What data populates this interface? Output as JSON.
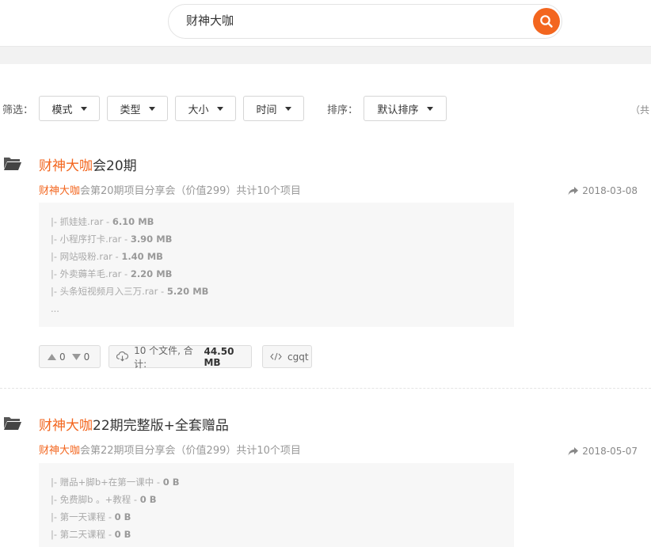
{
  "search": {
    "value": "财神大咖"
  },
  "filter": {
    "label": "筛选：",
    "dropdowns": [
      "模式",
      "类型",
      "大小",
      "时间"
    ],
    "sort_label": "排序：",
    "sort_value": "默认排序",
    "edge_text": "（共"
  },
  "results": [
    {
      "title_highlight": "财神大咖",
      "title_rest": "会20期",
      "desc_highlight": "财神大咖",
      "desc_rest": "会第20期项目分享会（价值299）共计10个项目",
      "date": "2018-03-08",
      "files": [
        {
          "name": "|- 抓娃娃.rar - ",
          "size": "6.10 MB"
        },
        {
          "name": "|- 小程序打卡.rar - ",
          "size": "3.90 MB"
        },
        {
          "name": "|- 网站吸粉.rar - ",
          "size": "1.40 MB"
        },
        {
          "name": "|- 外卖薅羊毛.rar - ",
          "size": "2.20 MB"
        },
        {
          "name": "|- 头条短视频月入三万.rar - ",
          "size": "5.20 MB"
        }
      ],
      "more": "...",
      "upvotes": "0",
      "downvotes": "0",
      "file_count": "10 个文件, 合计: ",
      "total_size": "44.50 MB",
      "code": "cgqt"
    },
    {
      "title_highlight": "财神大咖",
      "title_rest": "22期完整版+全套赠品",
      "desc_highlight": "财神大咖",
      "desc_rest": "会第22期项目分享会（价值299）共计10个项目",
      "date": "2018-05-07",
      "files": [
        {
          "name": "|- 赠品+脚b+在第一课中 - ",
          "size": "0 B"
        },
        {
          "name": "|- 免费脚b 。+教程 - ",
          "size": "0 B"
        },
        {
          "name": "|- 第一天课程 - ",
          "size": "0 B"
        },
        {
          "name": "|- 第二天课程 - ",
          "size": "0 B"
        }
      ]
    }
  ],
  "colors": {
    "accent": "#f3661f",
    "muted": "#999999"
  }
}
